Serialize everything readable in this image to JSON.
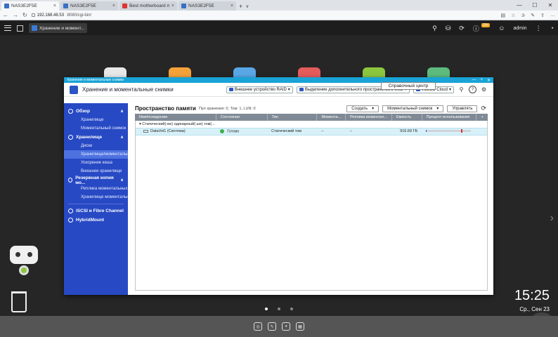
{
  "browser": {
    "tabs": [
      {
        "label": "NAS3E2F5E",
        "active": true
      },
      {
        "label": "NAS3E2F5E",
        "active": false
      },
      {
        "label": "Best motherboard manufac",
        "active": false
      },
      {
        "label": "NAS3E2F5E",
        "active": false
      }
    ],
    "url_host": "192.168.48.53",
    "url_path": ":8080/cgi-bin/"
  },
  "qts": {
    "app_tab_label": "Хранение и момент...",
    "user": "admin",
    "notif_badge": "10+"
  },
  "window": {
    "titlebar": "Хранение и моментальные снимки",
    "title": "Хранение и моментальные снимки",
    "btn_external_raid": "Внешнее устройство RAID",
    "btn_ssd": "Выделение дополнительного пространства в SSD",
    "btn_vjbod": "VJBOD Cloud",
    "tooltip": "Справочный центр"
  },
  "sidebar": {
    "overview": "Обзор",
    "overview_items": [
      "Хранилище",
      "Моментальный снимок"
    ],
    "storage": "Хранилище",
    "storage_items": [
      "Диски",
      "Хранилище/моментальн...",
      "Ускорение кеша",
      "Внешнее хранилище"
    ],
    "backup": "Резервная копия мо...",
    "backup_items": [
      "Реплика моментальных...",
      "Хранилище моментальн..."
    ],
    "iscsi": "iSCSI и Fibre Channel",
    "hybrid": "HybridMount"
  },
  "content": {
    "title": "Пространство памяти",
    "subtitle": "Пул хранения: 0, Том: 1, LUN: 0",
    "btn_create": "Создать",
    "btn_snapshot": "Моментальный снимок",
    "btn_manage": "Управлять",
    "columns": [
      "Имя/псевдоним",
      "Состояние",
      "Тип",
      "Момента...",
      "Реплика моментал...",
      "Емкость",
      "Процент использования",
      "+"
    ],
    "group_label": "Статический(-ие) одинарный(-ые) том(...",
    "row": {
      "name": "DataVol1 (Система)",
      "status": "Готово",
      "type": "Статический том",
      "snap": "--",
      "replica": "--",
      "capacity": "916.69 ГБ",
      "usage_fraction": 0.02
    }
  },
  "desktop": {
    "time": "15:25",
    "date": "Ср., Сен 23"
  }
}
